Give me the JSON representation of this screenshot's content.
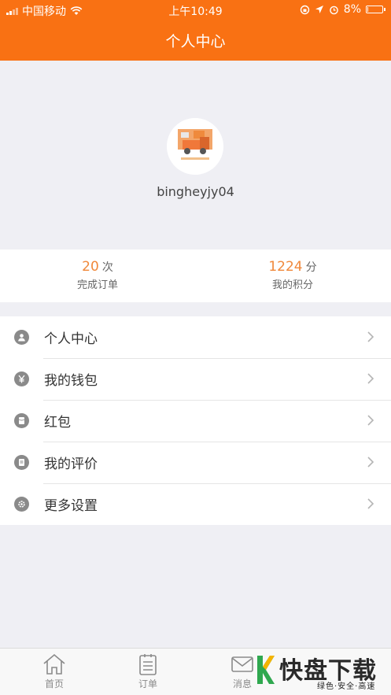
{
  "status_bar": {
    "carrier": "中国移动",
    "time": "上午10:49",
    "battery": "8%",
    "battery_level": 0.08
  },
  "header": {
    "title": "个人中心"
  },
  "profile": {
    "username": "bingheyjy04"
  },
  "stats": {
    "orders": {
      "value": "20",
      "unit": "次",
      "label": "完成订单"
    },
    "points": {
      "value": "1224",
      "unit": "分",
      "label": "我的积分"
    }
  },
  "menu": {
    "items": [
      {
        "label": "个人中心",
        "icon": "person-icon"
      },
      {
        "label": "我的钱包",
        "icon": "yen-icon"
      },
      {
        "label": "红包",
        "icon": "red-packet-icon"
      },
      {
        "label": "我的评价",
        "icon": "review-icon"
      },
      {
        "label": "更多设置",
        "icon": "gear-icon"
      }
    ]
  },
  "tabbar": {
    "tabs": [
      {
        "label": "首页",
        "icon": "home-icon"
      },
      {
        "label": "订单",
        "icon": "order-icon"
      },
      {
        "label": "消息",
        "icon": "message-icon"
      }
    ]
  },
  "watermark": {
    "main": "快盘下载",
    "sub": "绿色·安全·高速"
  },
  "colors": {
    "accent": "#f97113",
    "stat_value": "#f0883a",
    "watermark_green": "#2fa84f"
  }
}
